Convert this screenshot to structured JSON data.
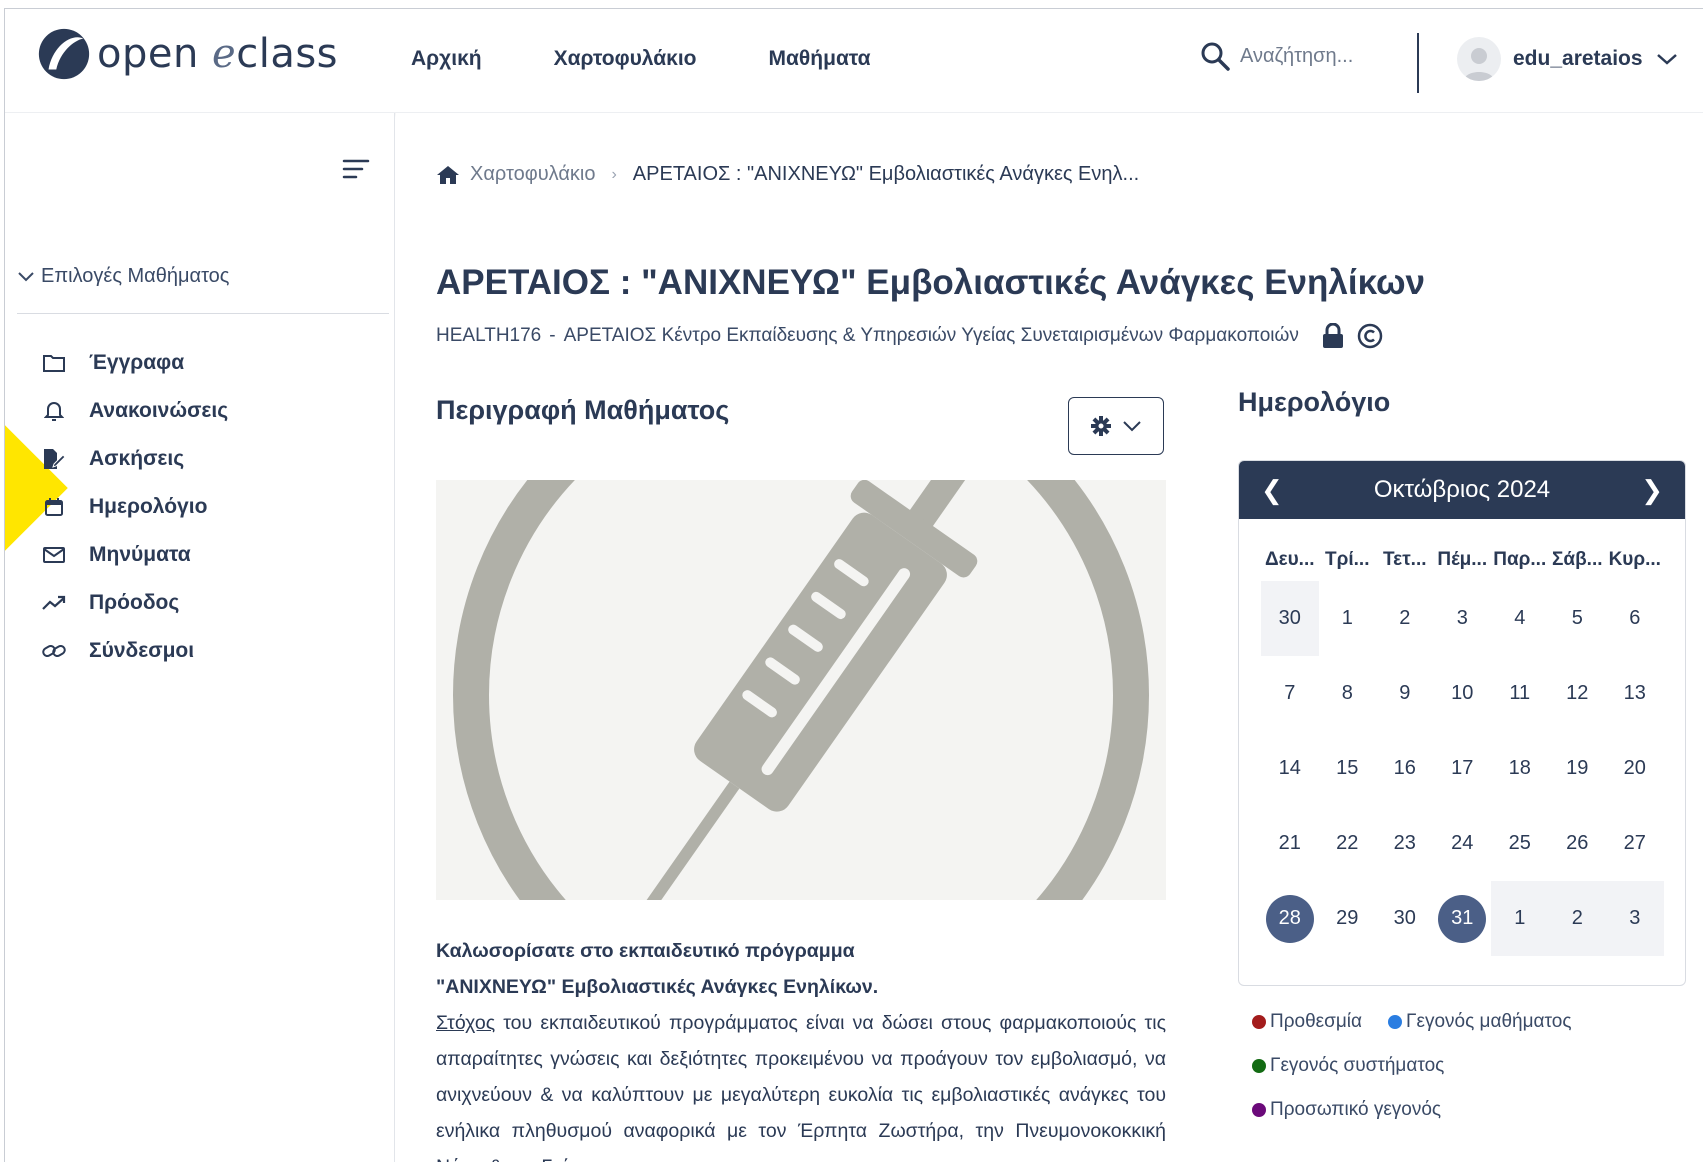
{
  "header": {
    "logo_text_a": "open",
    "logo_text_e": "e",
    "logo_text_b": "class",
    "nav": [
      "Αρχική",
      "Χαρτοφυλάκιο",
      "Μαθήματα"
    ],
    "search_placeholder": "Αναζήτηση...",
    "username": "edu_aretaios"
  },
  "sidebar": {
    "heading": "Επιλογές Μαθήματος",
    "items": [
      {
        "label": "Έγγραφα",
        "icon": "folder-icon"
      },
      {
        "label": "Ανακοινώσεις",
        "icon": "bell-icon"
      },
      {
        "label": "Ασκήσεις",
        "icon": "exercise-icon"
      },
      {
        "label": "Ημερολόγιο",
        "icon": "calendar-icon"
      },
      {
        "label": "Μηνύματα",
        "icon": "envelope-icon"
      },
      {
        "label": "Πρόοδος",
        "icon": "trend-icon"
      },
      {
        "label": "Σύνδεσμοι",
        "icon": "link-icon"
      }
    ]
  },
  "breadcrumb": {
    "home": "Χαρτοφυλάκιο",
    "current": "ΑΡΕΤΑΙΟΣ : \"ΑΝΙΧΝΕΥΩ\" Εμβολιαστικές Ανάγκες Ενηλ..."
  },
  "course": {
    "title": "ΑΡΕΤΑΙΟΣ : \"ΑΝΙΧΝΕΥΩ\" Εμβολιαστικές Ανάγκες Ενηλίκων",
    "code": "HEALTH176",
    "dash": "-",
    "institution": "ΑΡΕΤΑΙΟΣ Κέντρο Εκπαίδευσης & Υπηρεσιών Υγείας Συνεταιρισμένων Φαρμακοποιών",
    "description_title": "Περιγραφή Μαθήματος",
    "welcome_line1": "Καλωσορίσατε στο εκπαιδευτικό πρόγραμμα",
    "welcome_line2": "\"ΑΝΙΧΝΕΥΩ\" Εμβολιαστικές Ανάγκες Ενηλίκων.",
    "goal_word": "Στόχος",
    "goal_text": " του εκπαιδευτικού προγράμματος είναι να δώσει στους φαρμακοποιούς τις απαραίτητες γνώσεις και δεξιότητες προκειμένου να προάγουν τον εμβολιασμό, να ανιχνεύουν & να καλύπτουν με μεγαλύτερη ευκολία τις εμβολιαστικές ανάγκες του ενήλικα πληθυσμού αναφορικά με τον Έρπητα Ζωστήρα, την Πνευμονοκοκκική Νόσο & την Γρίπη."
  },
  "calendar": {
    "title": "Ημερολόγιο",
    "month": "Οκτώβριος 2024",
    "weekdays": [
      "Δευ...",
      "Τρί...",
      "Τετ...",
      "Πέμ...",
      "Παρ...",
      "Σάβ...",
      "Κυρ..."
    ],
    "days": [
      "30",
      "1",
      "2",
      "3",
      "4",
      "5",
      "6",
      "7",
      "8",
      "9",
      "10",
      "11",
      "12",
      "13",
      "14",
      "15",
      "16",
      "17",
      "18",
      "19",
      "20",
      "21",
      "22",
      "23",
      "24",
      "25",
      "26",
      "27",
      "28",
      "29",
      "30",
      "31",
      "1",
      "2",
      "3"
    ],
    "highlighted_days": [
      "28",
      "31"
    ],
    "legend": [
      {
        "label": "Προθεσμία",
        "color": "#a31c1c"
      },
      {
        "label": "Γεγονός μαθήματος",
        "color": "#2a7de1"
      },
      {
        "label": "Γεγονός συστήματος",
        "color": "#136b13"
      },
      {
        "label": "Προσωπικό γεγονός",
        "color": "#6b0a7a"
      }
    ]
  },
  "colors": {
    "primary": "#2b3a55",
    "calendar_header": "#2b3a55",
    "highlight_dot": "#4b5f87",
    "image_gray": "#b0b0a8",
    "annotation_yellow": "#ffe600"
  }
}
